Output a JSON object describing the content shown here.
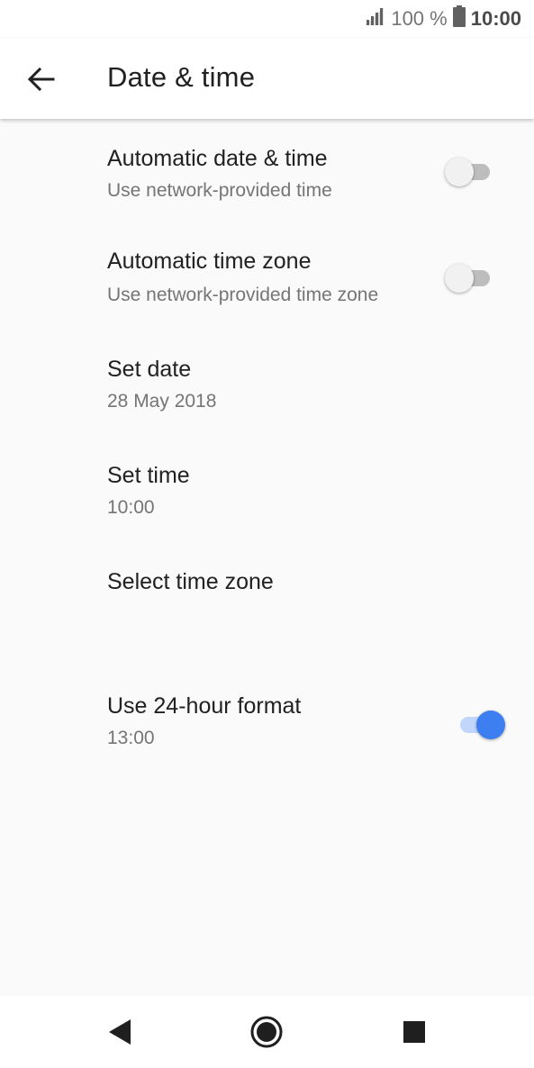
{
  "status_bar": {
    "battery_percent": "100 %",
    "time": "10:00",
    "icons": [
      "signal-icon",
      "battery-icon"
    ]
  },
  "app_bar": {
    "title": "Date & time",
    "back_icon": "back-arrow-icon"
  },
  "settings": [
    {
      "title": "Automatic date & time",
      "summary": "Use network-provided time",
      "toggle": "off"
    },
    {
      "title": "Automatic time zone",
      "summary": "Use network-provided time zone",
      "toggle": "off"
    },
    {
      "title": "Set date",
      "summary": "28 May 2018"
    },
    {
      "title": "Set time",
      "summary": "10:00"
    },
    {
      "title": "Select time zone"
    },
    {
      "title": "Use 24-hour format",
      "summary": "13:00",
      "toggle": "on"
    }
  ],
  "nav_bar": {
    "icons": [
      "back-triangle-icon",
      "home-circle-icon",
      "recents-square-icon"
    ]
  },
  "colors": {
    "accent": "#3d7ff0",
    "accent_track": "#c2d6fb",
    "background": "#fafafa"
  }
}
